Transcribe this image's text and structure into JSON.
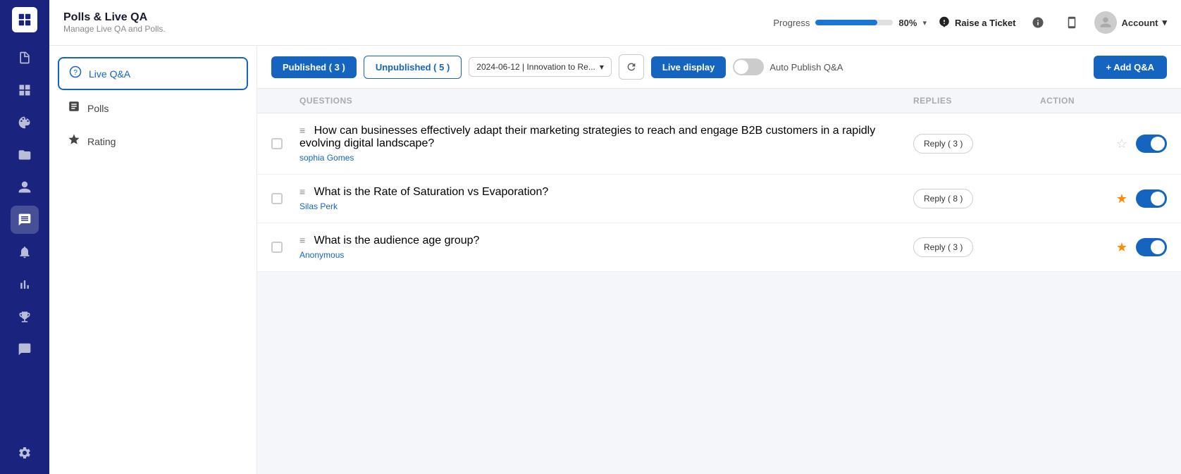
{
  "app": {
    "title": "Polls & Live QA",
    "subtitle": "Manage Live QA and Polls."
  },
  "header": {
    "progress_label": "Progress",
    "progress_percent": "80%",
    "progress_value": 80,
    "raise_ticket_label": "Raise a Ticket",
    "account_label": "Account"
  },
  "sidebar": {
    "items": [
      {
        "name": "page-icon",
        "icon": "📄",
        "active": false
      },
      {
        "name": "grid-icon",
        "icon": "⊞",
        "active": false
      },
      {
        "name": "palette-icon",
        "icon": "🎨",
        "active": false
      },
      {
        "name": "folder-icon",
        "icon": "📁",
        "active": false
      },
      {
        "name": "person-icon",
        "icon": "👤",
        "active": false
      },
      {
        "name": "chat-icon",
        "icon": "💬",
        "active": true
      },
      {
        "name": "bell-icon",
        "icon": "🔔",
        "active": false
      },
      {
        "name": "analytics-icon",
        "icon": "📊",
        "active": false
      },
      {
        "name": "trophy-icon",
        "icon": "🏆",
        "active": false
      },
      {
        "name": "bubble-icon",
        "icon": "💬",
        "active": false
      },
      {
        "name": "settings-icon",
        "icon": "⚙️",
        "active": false
      }
    ]
  },
  "left_nav": {
    "items": [
      {
        "label": "Live Q&A",
        "icon": "❓",
        "active": true
      },
      {
        "label": "Polls",
        "icon": "📋",
        "active": false
      },
      {
        "label": "Rating",
        "icon": "⭐",
        "active": false
      }
    ]
  },
  "toolbar": {
    "published_label": "Published ( 3 )",
    "unpublished_label": "Unpublished ( 5 )",
    "session_label": "2024-06-12 | Innovation to Re...",
    "live_display_label": "Live display",
    "auto_publish_label": "Auto Publish Q&A",
    "add_qa_label": "+ Add Q&A"
  },
  "table": {
    "headers": [
      "",
      "Questions",
      "Replies",
      "Action"
    ],
    "rows": [
      {
        "question": "How can businesses effectively adapt their marketing strategies to reach and engage B2B customers in a rapidly evolving digital landscape?",
        "author": "sophia Gomes",
        "reply_label": "Reply ( 3 )",
        "starred": false,
        "enabled": true
      },
      {
        "question": "What is the Rate of Saturation vs Evaporation?",
        "author": "Silas Perk",
        "reply_label": "Reply ( 8 )",
        "starred": true,
        "enabled": true
      },
      {
        "question": "What is the audience age group?",
        "author": "Anonymous",
        "reply_label": "Reply ( 3 )",
        "starred": true,
        "enabled": true
      }
    ]
  }
}
